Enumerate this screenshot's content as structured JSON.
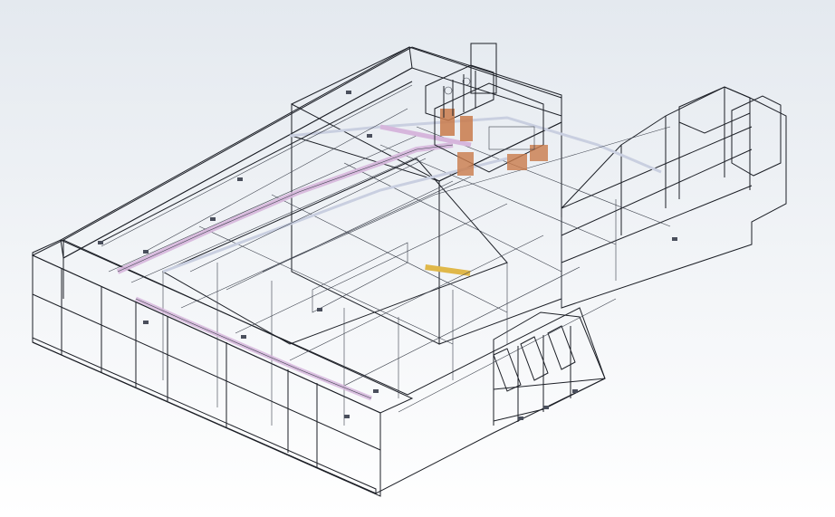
{
  "viewport": {
    "background_top": "#e4e9ef",
    "background_bottom": "#ffffff"
  },
  "model": {
    "shell_fill": "#a4a6bc",
    "face_fill": "#8e90aa",
    "roof_fill": "#b9bbcd",
    "edge_color": "#1c1f26",
    "duct_color": "#d6b6dc",
    "copper_color": "#c97a4a",
    "yellow_beam": "#e0b84a"
  }
}
